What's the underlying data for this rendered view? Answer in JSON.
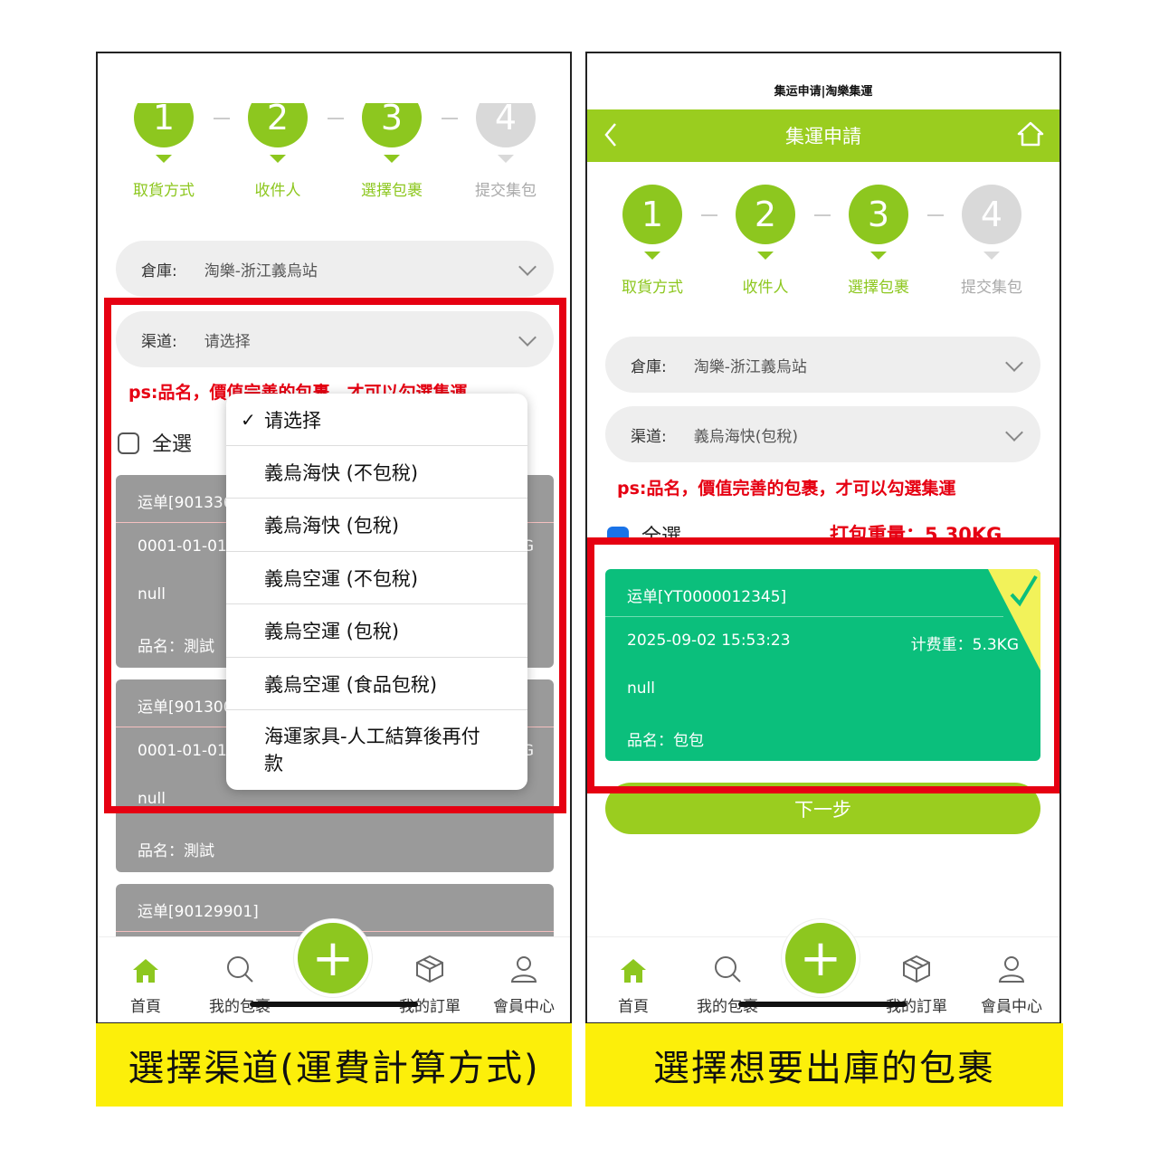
{
  "app_title": "集运申请|淘樂集運",
  "steps": [
    {
      "number": "1",
      "label": "取貨方式",
      "active": true
    },
    {
      "number": "2",
      "label": "收件人",
      "active": true
    },
    {
      "number": "3",
      "label": "選擇包裹",
      "active": true
    },
    {
      "number": "4",
      "label": "提交集包",
      "active": false
    }
  ],
  "colors": {
    "brand_green": "#8dc71f",
    "card_green": "#0bbf7c",
    "alert_red": "#e60012",
    "caption_yellow": "#fcef0a",
    "card_gray": "#9a9a9a"
  },
  "left": {
    "warehouse_label": "倉庫:",
    "warehouse_value": "淘樂-浙江義烏站",
    "channel_label": "渠道:",
    "channel_value": "请选择",
    "ps_text": "ps:品名，價值完善的包裹，才可以勾選集運",
    "select_all": "全選",
    "cards": [
      {
        "waybill": "运单[901336",
        "date": "0001-01-01",
        "null_text": "null",
        "name": "品名：測試",
        "side": "G"
      },
      {
        "waybill": "运单[901300",
        "date": "0001-01-01",
        "null_text": "null",
        "name": "品名：測試",
        "side": "G"
      },
      {
        "waybill": "运单[90129901]"
      }
    ],
    "dropdown": {
      "check": "✓",
      "options": [
        "请选择",
        "義烏海快 (不包稅)",
        "義烏海快 (包稅)",
        "義烏空運 (不包稅)",
        "義烏空運 (包稅)",
        "義烏空運 (食品包稅)",
        "海運家具-人工結算後再付款"
      ],
      "selected_index": 0
    },
    "caption": "選擇渠道(運費計算方式)"
  },
  "right": {
    "header_title": "集運申請",
    "back_icon": "chevron-left-icon",
    "home_icon": "home-outline-icon",
    "warehouse_label": "倉庫:",
    "warehouse_value": "淘樂-浙江義烏站",
    "channel_label": "渠道:",
    "channel_value": "義烏海快(包稅)",
    "ps_text": "ps:品名，價值完善的包裹，才可以勾選集運",
    "select_all": "全選",
    "pack_weight": "打包重量：5.30KG",
    "card": {
      "waybill": "运单[YT0000012345]",
      "date": "2025-09-02 15:53:23",
      "weight": "计费重：5.3KG",
      "null_text": "null",
      "name": "品名：包包",
      "selected": true
    },
    "next_button": "下一步",
    "caption": "選擇想要出庫的包裹"
  },
  "tabs": [
    "首頁",
    "我的包裹",
    "我的訂單",
    "會員中心"
  ],
  "plus_symbol": "+"
}
